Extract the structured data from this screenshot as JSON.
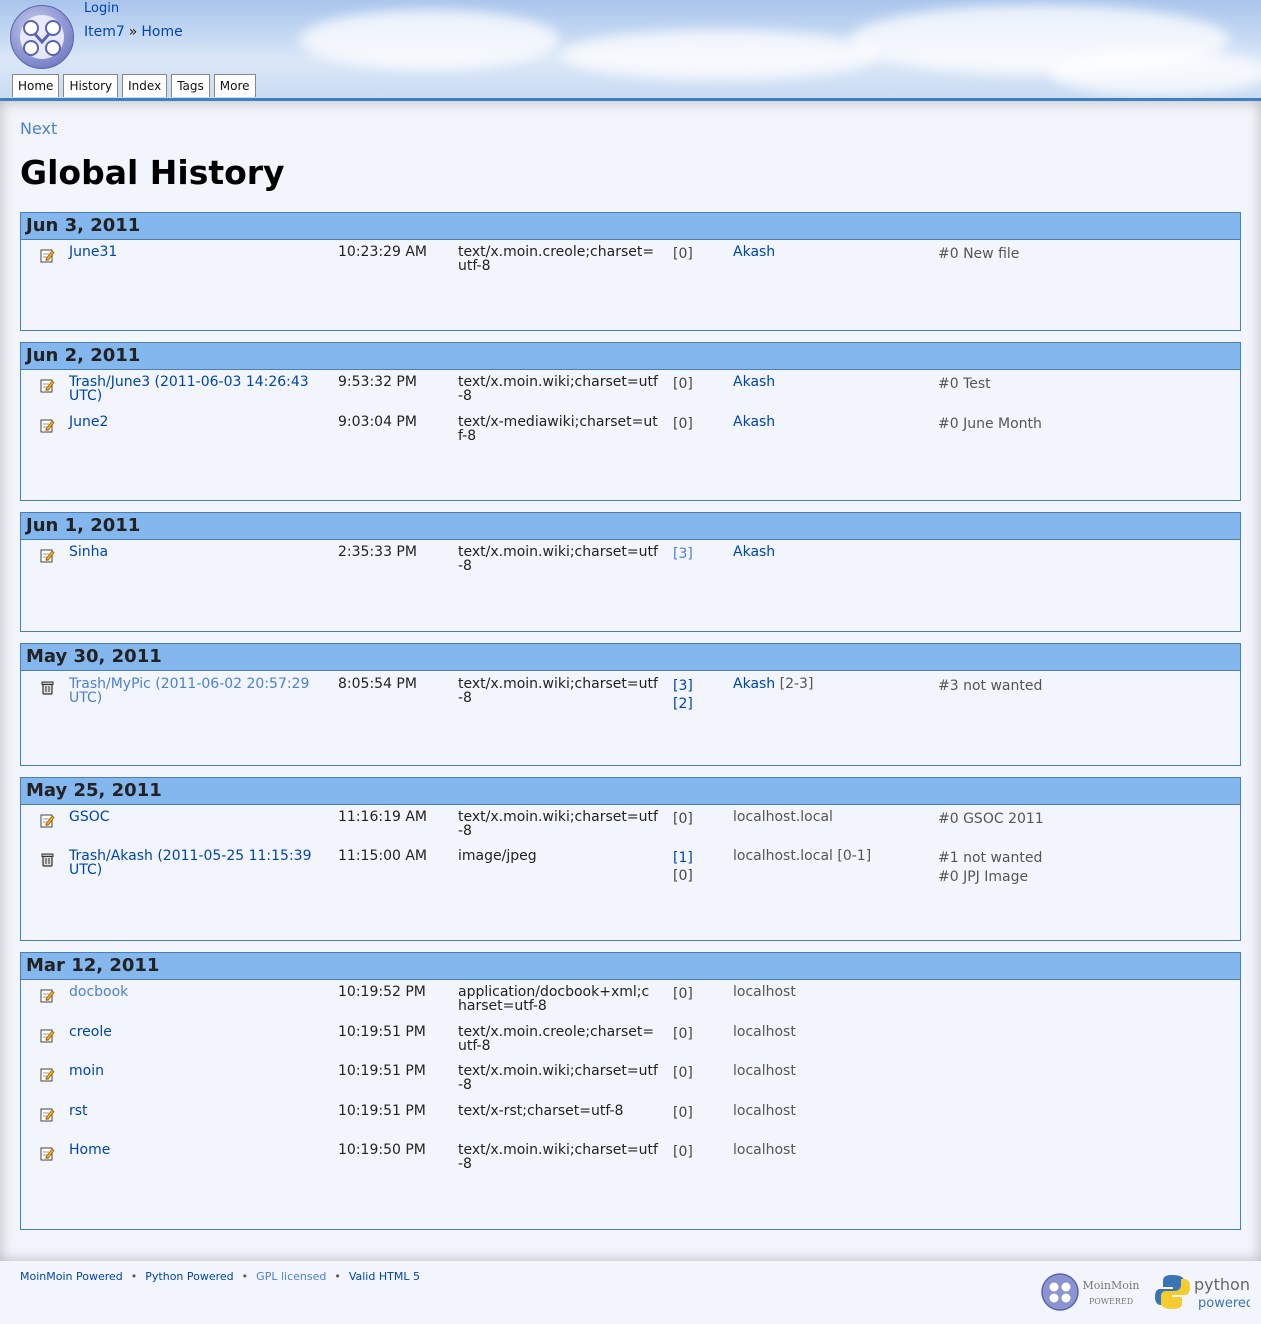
{
  "header": {
    "login": "Login",
    "breadcrumb": {
      "item": "Item7",
      "sep": "»",
      "home": "Home"
    },
    "tabs": [
      "Home",
      "History",
      "Index",
      "Tags",
      "More"
    ]
  },
  "main": {
    "next_link": "Next",
    "title": "Global History",
    "days": [
      {
        "date": "Jun 3, 2011",
        "rows": [
          {
            "icon": "edit-icon",
            "name": "June31",
            "time": "10:23:29 AM",
            "ctype": "text/x.moin.creole;charset=utf-8",
            "revs": [
              "[0]"
            ],
            "editor": "Akash",
            "editor_range": "",
            "comments": [
              "#0 New file"
            ]
          }
        ]
      },
      {
        "date": "Jun 2, 2011",
        "rows": [
          {
            "icon": "edit-icon",
            "name": "Trash/June3 (2011-06-03 14:26:43 UTC)",
            "time": "9:53:32 PM",
            "ctype": "text/x.moin.wiki;charset=utf-8",
            "revs": [
              "[0]"
            ],
            "editor": "Akash",
            "editor_range": "",
            "comments": [
              "#0 Test"
            ]
          },
          {
            "icon": "edit-icon",
            "name": "June2",
            "time": "9:03:04 PM",
            "ctype": "text/x-mediawiki;charset=utf-8",
            "revs": [
              "[0]"
            ],
            "editor": "Akash",
            "editor_range": "",
            "comments": [
              "#0 June Month"
            ]
          }
        ]
      },
      {
        "date": "Jun 1, 2011",
        "rows": [
          {
            "icon": "edit-icon",
            "name": "Sinha",
            "time": "2:35:33 PM",
            "ctype": "text/x.moin.wiki;charset=utf-8",
            "revs": [
              "[3]"
            ],
            "editor": "Akash",
            "editor_range": "",
            "comments": []
          }
        ]
      },
      {
        "date": "May 30, 2011",
        "rows": [
          {
            "icon": "trash-icon",
            "name": "Trash/MyPic (2011-06-02 20:57:29 UTC)",
            "time": "8:05:54 PM",
            "ctype": "text/x.moin.wiki;charset=utf-8",
            "revs": [
              "[3]",
              "[2]"
            ],
            "editor": "Akash",
            "editor_range": "[2-3]",
            "comments": [
              "#3 not wanted"
            ]
          }
        ]
      },
      {
        "date": "May 25, 2011",
        "rows": [
          {
            "icon": "edit-icon",
            "name": "GSOC",
            "time": "11:16:19 AM",
            "ctype": "text/x.moin.wiki;charset=utf-8",
            "revs": [
              "[0]"
            ],
            "editor": "localhost.local",
            "editor_range": "",
            "comments": [
              "#0 GSOC 2011"
            ]
          },
          {
            "icon": "trash-icon",
            "name": "Trash/Akash (2011-05-25 11:15:39 UTC)",
            "time": "11:15:00 AM",
            "ctype": "image/jpeg",
            "revs": [
              "[1]",
              "[0]"
            ],
            "editor": "localhost.local",
            "editor_range": "[0-1]",
            "comments": [
              "#1 not wanted",
              "#0 JPJ Image"
            ]
          }
        ]
      },
      {
        "date": "Mar 12, 2011",
        "rows": [
          {
            "icon": "edit-icon",
            "name": "docbook",
            "time": "10:19:52 PM",
            "ctype": "application/docbook+xml;charset=utf-8",
            "revs": [
              "[0]"
            ],
            "editor": "localhost",
            "editor_range": "",
            "comments": []
          },
          {
            "icon": "edit-icon",
            "name": "creole",
            "time": "10:19:51 PM",
            "ctype": "text/x.moin.creole;charset=utf-8",
            "revs": [
              "[0]"
            ],
            "editor": "localhost",
            "editor_range": "",
            "comments": []
          },
          {
            "icon": "edit-icon",
            "name": "moin",
            "time": "10:19:51 PM",
            "ctype": "text/x.moin.wiki;charset=utf-8",
            "revs": [
              "[0]"
            ],
            "editor": "localhost",
            "editor_range": "",
            "comments": []
          },
          {
            "icon": "edit-icon",
            "name": "rst",
            "time": "10:19:51 PM",
            "ctype": "text/x-rst;charset=utf-8",
            "revs": [
              "[0]"
            ],
            "editor": "localhost",
            "editor_range": "",
            "comments": []
          },
          {
            "icon": "edit-icon",
            "name": "Home",
            "time": "10:19:50 PM",
            "ctype": "text/x.moin.wiki;charset=utf-8",
            "revs": [
              "[0]"
            ],
            "editor": "localhost",
            "editor_range": "",
            "comments": []
          }
        ]
      }
    ]
  },
  "footer": {
    "links": [
      "MoinMoin Powered",
      "Python Powered",
      "GPL licensed",
      "Valid HTML 5"
    ],
    "separator": "•",
    "moin_badge": {
      "line1": "MoinMoin",
      "line2": "POWERED"
    },
    "python_badge": {
      "line1": "python",
      "line2": "powered"
    }
  },
  "colors": {
    "link": "#0044b3",
    "link_visited": "#4d7fd6",
    "day_header_bg": "#84b7ee",
    "day_border": "#4a7fb5",
    "content_bg": "#f2f5fb"
  }
}
